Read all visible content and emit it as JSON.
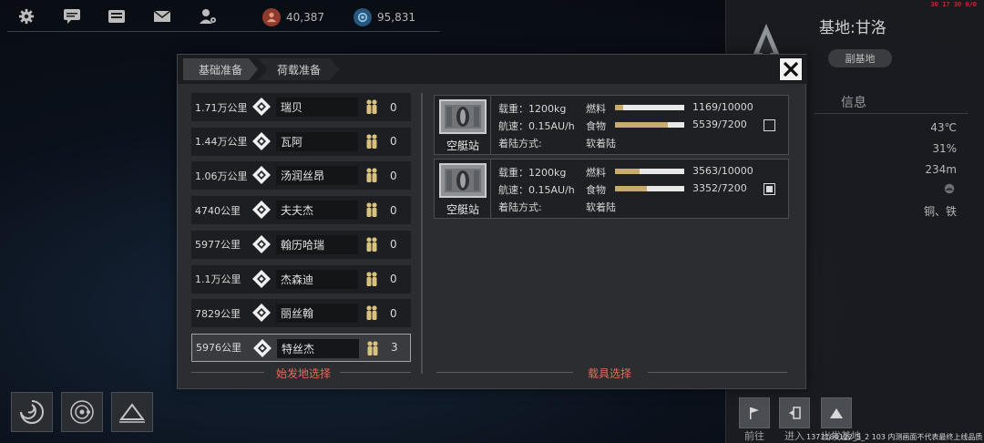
{
  "top_bar": {
    "icons": [
      "gear-icon",
      "chat-icon",
      "keyboard-icon",
      "mail-icon",
      "user-settings-icon"
    ],
    "resource_1": {
      "icon": "population-icon",
      "value": "40,387"
    },
    "resource_2": {
      "icon": "research-icon",
      "value": "95,831"
    },
    "corner_text": "30 17 30 0/0"
  },
  "side_panel": {
    "base_title": "基地:甘洛",
    "sub_base_button": "副基地",
    "info_title": "信息",
    "stats": [
      "43℃",
      "31%",
      "234m",
      "铜、铁"
    ],
    "actions": [
      {
        "icon": "flag-icon",
        "label": "前往"
      },
      {
        "icon": "enter-icon",
        "label": "进入"
      },
      {
        "icon": "mountain-icon",
        "label": "出发基地"
      }
    ],
    "footnote": "1373184122_5_2 103  内测画面不代表最终上线品质"
  },
  "modal": {
    "tabs": [
      "基础准备",
      "荷载准备"
    ],
    "destinations": [
      {
        "distance": "1.71万公里",
        "name": "瑞贝",
        "count": "0",
        "selected": false
      },
      {
        "distance": "1.44万公里",
        "name": "瓦阿",
        "count": "0",
        "selected": false
      },
      {
        "distance": "1.06万公里",
        "name": "汤润丝昂",
        "count": "0",
        "selected": false
      },
      {
        "distance": "4740公里",
        "name": "夫夫杰",
        "count": "0",
        "selected": false
      },
      {
        "distance": "5977公里",
        "name": "翰历哈瑞",
        "count": "0",
        "selected": false
      },
      {
        "distance": "1.1万公里",
        "name": "杰森迪",
        "count": "0",
        "selected": false
      },
      {
        "distance": "7829公里",
        "name": "丽丝翰",
        "count": "0",
        "selected": false
      },
      {
        "distance": "5976公里",
        "name": "特丝杰",
        "count": "3",
        "selected": true
      }
    ],
    "left_caption": "始发地选择",
    "right_caption": "载具选择",
    "vehicles": [
      {
        "name": "空艇站",
        "load_label": "载重：1200kg",
        "speed_label": "航速：0.15AU/h",
        "landing_label": "着陆方式:",
        "landing_value": "软着陆",
        "fuel_label": "燃料",
        "fuel_text": "1169/10000",
        "fuel_fraction": 0.117,
        "food_label": "食物",
        "food_text": "5539/7200",
        "food_fraction": 0.769,
        "checked": false
      },
      {
        "name": "空艇站",
        "load_label": "载重：1200kg",
        "speed_label": "航速：0.15AU/h",
        "landing_label": "着陆方式:",
        "landing_value": "软着陆",
        "fuel_label": "燃料",
        "fuel_text": "3563/10000",
        "fuel_fraction": 0.356,
        "food_label": "食物",
        "food_text": "3352/7200",
        "food_fraction": 0.466,
        "checked": true
      }
    ]
  },
  "bottom_left": [
    "galaxy-icon",
    "orbit-icon",
    "terrain-icon"
  ],
  "colors": {
    "accent_red": "#e26a5b",
    "bar_fill": "#c8ab6e",
    "gold": "#d8c27e"
  }
}
